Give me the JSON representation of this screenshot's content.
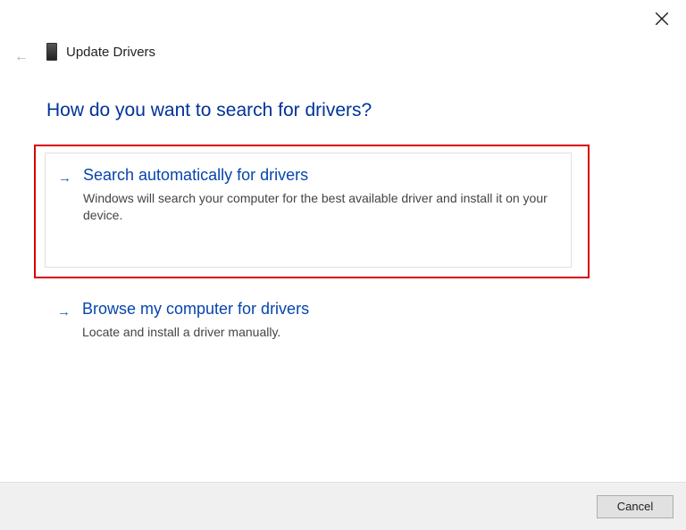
{
  "window": {
    "title": "Update Drivers"
  },
  "heading": "How do you want to search for drivers?",
  "options": {
    "auto": {
      "title": "Search automatically for drivers",
      "desc": "Windows will search your computer for the best available driver and install it on your device."
    },
    "browse": {
      "title": "Browse my computer for drivers",
      "desc": "Locate and install a driver manually."
    }
  },
  "footer": {
    "cancel": "Cancel"
  }
}
